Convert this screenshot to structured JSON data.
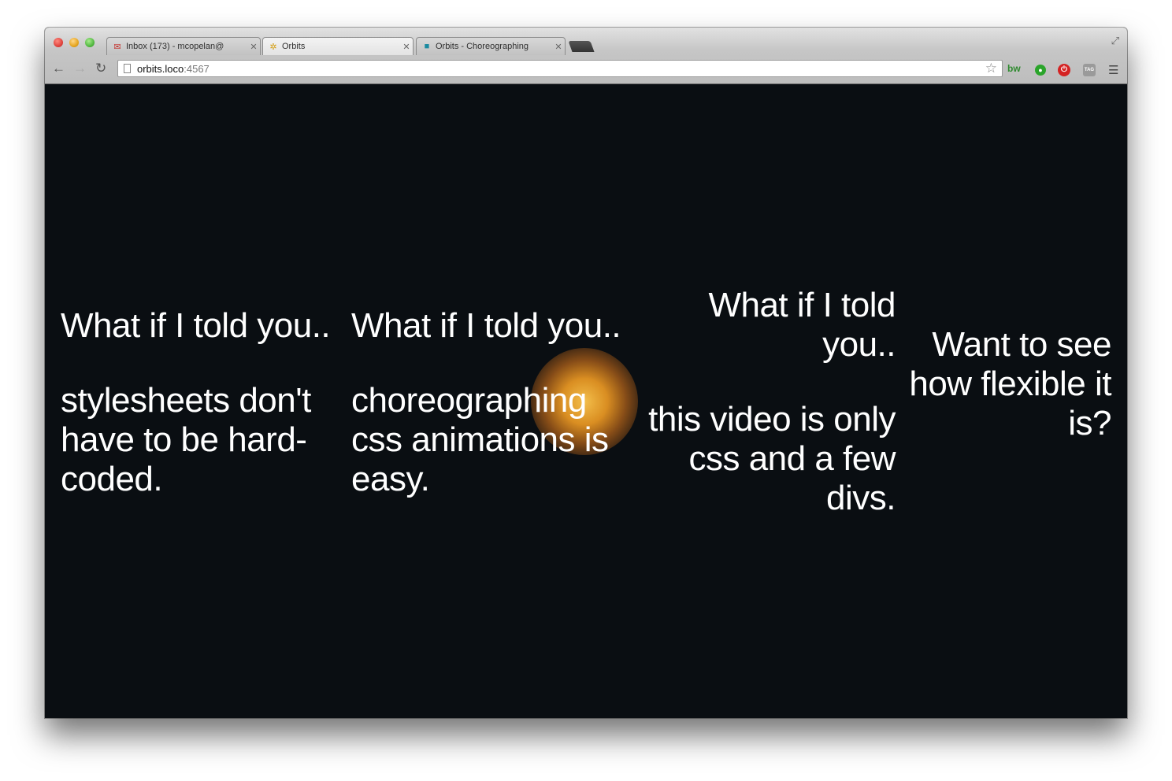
{
  "browser": {
    "tabs": [
      {
        "label": "Inbox (173) - mcopelan@",
        "icon": "gmail-icon",
        "active": false
      },
      {
        "label": "Orbits",
        "icon": "orbits-icon",
        "active": true
      },
      {
        "label": "Orbits - Choreographing",
        "icon": "orbits-icon",
        "active": false
      }
    ],
    "address": {
      "host": "orbits.loco",
      "port": ":4567"
    }
  },
  "slides": {
    "col1": {
      "heading": "What if I told you..",
      "body": "stylesheets don't have to be hard-coded."
    },
    "col2": {
      "heading": "What if I told you..",
      "body": "choreographing css animations is easy."
    },
    "col3": {
      "heading": "What if I told you..",
      "body": "this video is only css and a few divs."
    },
    "col4": {
      "heading": "Want to see how flexible it is?"
    }
  },
  "colors": {
    "background": "#0a0e12",
    "text": "#ffffff",
    "glow": "#ffa014"
  }
}
